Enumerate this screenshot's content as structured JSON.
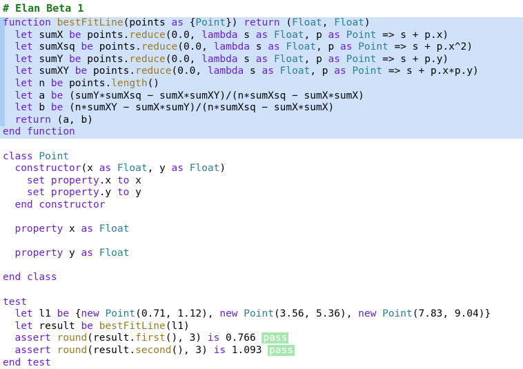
{
  "app": {
    "title": "# Elan Beta 1",
    "language": "elan",
    "colors": {
      "title_green": "#1a7a1a",
      "keyword_purple": "#6a1fd0",
      "type_teal": "#2b7f8e",
      "function_olive": "#9a7a26",
      "plain_black": "#000000",
      "selection_blue": "#cfe2fa",
      "gutter_blue": "#a9cdf3",
      "pass_badge_green": "#a8e6b0",
      "background": "#ffffff"
    },
    "status_labels": {
      "pass": "pass"
    }
  },
  "code": {
    "lines": [
      {
        "id": "line-1",
        "highlight": "block",
        "tokens": [
          {
            "t": "function",
            "c": "kw"
          },
          {
            "t": " ",
            "c": "pl"
          },
          {
            "t": "bestFitLine",
            "c": "fn"
          },
          {
            "t": "(",
            "c": "pl"
          },
          {
            "t": "points",
            "c": "pl"
          },
          {
            "t": " ",
            "c": "pl"
          },
          {
            "t": "as",
            "c": "kw"
          },
          {
            "t": " {",
            "c": "pl"
          },
          {
            "t": "Point",
            "c": "typ"
          },
          {
            "t": "}) ",
            "c": "pl"
          },
          {
            "t": "return",
            "c": "kw"
          },
          {
            "t": " (",
            "c": "pl"
          },
          {
            "t": "Float",
            "c": "typ"
          },
          {
            "t": ", ",
            "c": "pl"
          },
          {
            "t": "Float",
            "c": "typ"
          },
          {
            "t": ")",
            "c": "pl"
          }
        ]
      },
      {
        "id": "line-2",
        "highlight": "block",
        "tokens": [
          {
            "t": "  ",
            "c": "pl"
          },
          {
            "t": "let",
            "c": "kw"
          },
          {
            "t": " sumX ",
            "c": "pl"
          },
          {
            "t": "be",
            "c": "kw"
          },
          {
            "t": " points.",
            "c": "pl"
          },
          {
            "t": "reduce",
            "c": "fn"
          },
          {
            "t": "(0.0, ",
            "c": "pl"
          },
          {
            "t": "lambda",
            "c": "kw"
          },
          {
            "t": " s ",
            "c": "pl"
          },
          {
            "t": "as",
            "c": "kw"
          },
          {
            "t": " ",
            "c": "pl"
          },
          {
            "t": "Float",
            "c": "typ"
          },
          {
            "t": ", p ",
            "c": "pl"
          },
          {
            "t": "as",
            "c": "kw"
          },
          {
            "t": " ",
            "c": "pl"
          },
          {
            "t": "Point",
            "c": "typ"
          },
          {
            "t": " => s + p.x)",
            "c": "pl"
          }
        ]
      },
      {
        "id": "line-3",
        "highlight": "block",
        "tokens": [
          {
            "t": "  ",
            "c": "pl"
          },
          {
            "t": "let",
            "c": "kw"
          },
          {
            "t": " sumXsq ",
            "c": "pl"
          },
          {
            "t": "be",
            "c": "kw"
          },
          {
            "t": " points.",
            "c": "pl"
          },
          {
            "t": "reduce",
            "c": "fn"
          },
          {
            "t": "(0.0, ",
            "c": "pl"
          },
          {
            "t": "lambda",
            "c": "kw"
          },
          {
            "t": " s ",
            "c": "pl"
          },
          {
            "t": "as",
            "c": "kw"
          },
          {
            "t": " ",
            "c": "pl"
          },
          {
            "t": "Float",
            "c": "typ"
          },
          {
            "t": ", p ",
            "c": "pl"
          },
          {
            "t": "as",
            "c": "kw"
          },
          {
            "t": " ",
            "c": "pl"
          },
          {
            "t": "Point",
            "c": "typ"
          },
          {
            "t": " => s + p.x^2)",
            "c": "pl"
          }
        ]
      },
      {
        "id": "line-4",
        "highlight": "block",
        "tokens": [
          {
            "t": "  ",
            "c": "pl"
          },
          {
            "t": "let",
            "c": "kw"
          },
          {
            "t": " sumY ",
            "c": "pl"
          },
          {
            "t": "be",
            "c": "kw"
          },
          {
            "t": " points.",
            "c": "pl"
          },
          {
            "t": "reduce",
            "c": "fn"
          },
          {
            "t": "(0.0, ",
            "c": "pl"
          },
          {
            "t": "lambda",
            "c": "kw"
          },
          {
            "t": " s ",
            "c": "pl"
          },
          {
            "t": "as",
            "c": "kw"
          },
          {
            "t": " ",
            "c": "pl"
          },
          {
            "t": "Float",
            "c": "typ"
          },
          {
            "t": ", p ",
            "c": "pl"
          },
          {
            "t": "as",
            "c": "kw"
          },
          {
            "t": " ",
            "c": "pl"
          },
          {
            "t": "Point",
            "c": "typ"
          },
          {
            "t": " => s + p.y)",
            "c": "pl"
          }
        ]
      },
      {
        "id": "line-5",
        "highlight": "block",
        "tokens": [
          {
            "t": "  ",
            "c": "pl"
          },
          {
            "t": "let",
            "c": "kw"
          },
          {
            "t": " sumXY ",
            "c": "pl"
          },
          {
            "t": "be",
            "c": "kw"
          },
          {
            "t": " points.",
            "c": "pl"
          },
          {
            "t": "reduce",
            "c": "fn"
          },
          {
            "t": "(0.0, ",
            "c": "pl"
          },
          {
            "t": "lambda",
            "c": "kw"
          },
          {
            "t": " s ",
            "c": "pl"
          },
          {
            "t": "as",
            "c": "kw"
          },
          {
            "t": " ",
            "c": "pl"
          },
          {
            "t": "Float",
            "c": "typ"
          },
          {
            "t": ", p ",
            "c": "pl"
          },
          {
            "t": "as",
            "c": "kw"
          },
          {
            "t": " ",
            "c": "pl"
          },
          {
            "t": "Point",
            "c": "typ"
          },
          {
            "t": " => s + p.x∗p.y)",
            "c": "pl"
          }
        ]
      },
      {
        "id": "line-6",
        "highlight": "block",
        "tokens": [
          {
            "t": "  ",
            "c": "pl"
          },
          {
            "t": "let",
            "c": "kw"
          },
          {
            "t": " n ",
            "c": "pl"
          },
          {
            "t": "be",
            "c": "kw"
          },
          {
            "t": " points.",
            "c": "pl"
          },
          {
            "t": "length",
            "c": "fn"
          },
          {
            "t": "()",
            "c": "pl"
          }
        ]
      },
      {
        "id": "line-7",
        "highlight": "block",
        "tokens": [
          {
            "t": "  ",
            "c": "pl"
          },
          {
            "t": "let",
            "c": "kw"
          },
          {
            "t": " a ",
            "c": "pl"
          },
          {
            "t": "be",
            "c": "kw"
          },
          {
            "t": " (sumY∗sumXsq − sumX∗sumXY)/(n∗sumXsq − sumX∗sumX)",
            "c": "pl"
          }
        ]
      },
      {
        "id": "line-8",
        "highlight": "block",
        "tokens": [
          {
            "t": "  ",
            "c": "pl"
          },
          {
            "t": "let",
            "c": "kw"
          },
          {
            "t": " b ",
            "c": "pl"
          },
          {
            "t": "be",
            "c": "kw"
          },
          {
            "t": " (n∗sumXY − sumX∗sumY)/(n∗sumXsq − sumX∗sumX)",
            "c": "pl"
          }
        ]
      },
      {
        "id": "line-9",
        "highlight": "block",
        "tokens": [
          {
            "t": "  ",
            "c": "pl"
          },
          {
            "t": "return",
            "c": "kw"
          },
          {
            "t": " (a, b)",
            "c": "pl"
          }
        ]
      },
      {
        "id": "line-10",
        "highlight": "block-end",
        "tokens": [
          {
            "t": "end",
            "c": "kw"
          },
          {
            "t": " ",
            "c": "pl"
          },
          {
            "t": "function",
            "c": "kw"
          }
        ]
      },
      {
        "id": "line-11",
        "highlight": "none",
        "tokens": []
      },
      {
        "id": "line-12",
        "highlight": "none",
        "tokens": [
          {
            "t": "class",
            "c": "kw"
          },
          {
            "t": " ",
            "c": "pl"
          },
          {
            "t": "Point",
            "c": "typ"
          }
        ]
      },
      {
        "id": "line-13",
        "highlight": "none",
        "tokens": [
          {
            "t": "  ",
            "c": "pl"
          },
          {
            "t": "constructor",
            "c": "kw"
          },
          {
            "t": "(x ",
            "c": "pl"
          },
          {
            "t": "as",
            "c": "kw"
          },
          {
            "t": " ",
            "c": "pl"
          },
          {
            "t": "Float",
            "c": "typ"
          },
          {
            "t": ", y ",
            "c": "pl"
          },
          {
            "t": "as",
            "c": "kw"
          },
          {
            "t": " ",
            "c": "pl"
          },
          {
            "t": "Float",
            "c": "typ"
          },
          {
            "t": ")",
            "c": "pl"
          }
        ]
      },
      {
        "id": "line-14",
        "highlight": "none",
        "tokens": [
          {
            "t": "    ",
            "c": "pl"
          },
          {
            "t": "set",
            "c": "kw"
          },
          {
            "t": " ",
            "c": "pl"
          },
          {
            "t": "property",
            "c": "kw"
          },
          {
            "t": ".x ",
            "c": "pl"
          },
          {
            "t": "to",
            "c": "kw"
          },
          {
            "t": " x",
            "c": "pl"
          }
        ]
      },
      {
        "id": "line-15",
        "highlight": "none",
        "tokens": [
          {
            "t": "    ",
            "c": "pl"
          },
          {
            "t": "set",
            "c": "kw"
          },
          {
            "t": " ",
            "c": "pl"
          },
          {
            "t": "property",
            "c": "kw"
          },
          {
            "t": ".y ",
            "c": "pl"
          },
          {
            "t": "to",
            "c": "kw"
          },
          {
            "t": " y",
            "c": "pl"
          }
        ]
      },
      {
        "id": "line-16",
        "highlight": "none",
        "tokens": [
          {
            "t": "  ",
            "c": "pl"
          },
          {
            "t": "end",
            "c": "kw"
          },
          {
            "t": " ",
            "c": "pl"
          },
          {
            "t": "constructor",
            "c": "kw"
          }
        ]
      },
      {
        "id": "line-17",
        "highlight": "none",
        "tokens": []
      },
      {
        "id": "line-18",
        "highlight": "none",
        "tokens": [
          {
            "t": "  ",
            "c": "pl"
          },
          {
            "t": "property",
            "c": "kw"
          },
          {
            "t": " x ",
            "c": "pl"
          },
          {
            "t": "as",
            "c": "kw"
          },
          {
            "t": " ",
            "c": "pl"
          },
          {
            "t": "Float",
            "c": "typ"
          }
        ]
      },
      {
        "id": "line-19",
        "highlight": "none",
        "tokens": []
      },
      {
        "id": "line-20",
        "highlight": "none",
        "tokens": [
          {
            "t": "  ",
            "c": "pl"
          },
          {
            "t": "property",
            "c": "kw"
          },
          {
            "t": " y ",
            "c": "pl"
          },
          {
            "t": "as",
            "c": "kw"
          },
          {
            "t": " ",
            "c": "pl"
          },
          {
            "t": "Float",
            "c": "typ"
          }
        ]
      },
      {
        "id": "line-21",
        "highlight": "none",
        "tokens": []
      },
      {
        "id": "line-22",
        "highlight": "none",
        "tokens": [
          {
            "t": "end",
            "c": "kw"
          },
          {
            "t": " ",
            "c": "pl"
          },
          {
            "t": "class",
            "c": "kw"
          }
        ]
      },
      {
        "id": "line-23",
        "highlight": "none",
        "tokens": []
      },
      {
        "id": "line-24",
        "highlight": "none",
        "tokens": [
          {
            "t": "test",
            "c": "kw"
          }
        ]
      },
      {
        "id": "line-25",
        "highlight": "none",
        "tokens": [
          {
            "t": "  ",
            "c": "pl"
          },
          {
            "t": "let",
            "c": "kw"
          },
          {
            "t": " l1 ",
            "c": "pl"
          },
          {
            "t": "be",
            "c": "kw"
          },
          {
            "t": " {",
            "c": "pl"
          },
          {
            "t": "new",
            "c": "kw"
          },
          {
            "t": " ",
            "c": "pl"
          },
          {
            "t": "Point",
            "c": "typ"
          },
          {
            "t": "(0.71, 1.12), ",
            "c": "pl"
          },
          {
            "t": "new",
            "c": "kw"
          },
          {
            "t": " ",
            "c": "pl"
          },
          {
            "t": "Point",
            "c": "typ"
          },
          {
            "t": "(3.56, 5.36), ",
            "c": "pl"
          },
          {
            "t": "new",
            "c": "kw"
          },
          {
            "t": " ",
            "c": "pl"
          },
          {
            "t": "Point",
            "c": "typ"
          },
          {
            "t": "(7.83, 9.04)}",
            "c": "pl"
          }
        ]
      },
      {
        "id": "line-26",
        "highlight": "none",
        "tokens": [
          {
            "t": "  ",
            "c": "pl"
          },
          {
            "t": "let",
            "c": "kw"
          },
          {
            "t": " result ",
            "c": "pl"
          },
          {
            "t": "be",
            "c": "kw"
          },
          {
            "t": " ",
            "c": "pl"
          },
          {
            "t": "bestFitLine",
            "c": "fn"
          },
          {
            "t": "(l1)",
            "c": "pl"
          }
        ]
      },
      {
        "id": "line-27",
        "highlight": "none",
        "badge": "pass",
        "tokens": [
          {
            "t": "  ",
            "c": "pl"
          },
          {
            "t": "assert",
            "c": "kw"
          },
          {
            "t": " ",
            "c": "pl"
          },
          {
            "t": "round",
            "c": "fn"
          },
          {
            "t": "(result.",
            "c": "pl"
          },
          {
            "t": "first",
            "c": "fn"
          },
          {
            "t": "(), 3) ",
            "c": "pl"
          },
          {
            "t": "is",
            "c": "kw"
          },
          {
            "t": " 0.766 ",
            "c": "pl"
          }
        ]
      },
      {
        "id": "line-28",
        "highlight": "none",
        "badge": "pass",
        "tokens": [
          {
            "t": "  ",
            "c": "pl"
          },
          {
            "t": "assert",
            "c": "kw"
          },
          {
            "t": " ",
            "c": "pl"
          },
          {
            "t": "round",
            "c": "fn"
          },
          {
            "t": "(result.",
            "c": "pl"
          },
          {
            "t": "second",
            "c": "fn"
          },
          {
            "t": "(), 3) ",
            "c": "pl"
          },
          {
            "t": "is",
            "c": "kw"
          },
          {
            "t": " 1.093 ",
            "c": "pl"
          }
        ]
      },
      {
        "id": "line-29",
        "highlight": "none",
        "tokens": [
          {
            "t": "end",
            "c": "kw"
          },
          {
            "t": " ",
            "c": "pl"
          },
          {
            "t": "test",
            "c": "kw"
          }
        ]
      }
    ]
  }
}
